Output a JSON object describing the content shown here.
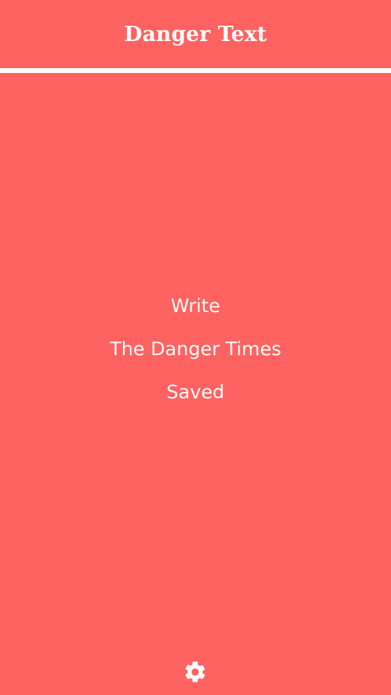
{
  "header": {
    "title": "Danger Text"
  },
  "menu": {
    "items": [
      {
        "label": "Write"
      },
      {
        "label": "The Danger Times"
      },
      {
        "label": "Saved"
      }
    ]
  },
  "footer": {
    "settings_icon": "gear-icon"
  },
  "colors": {
    "background": "#ff6361",
    "foreground": "#ffffff"
  }
}
